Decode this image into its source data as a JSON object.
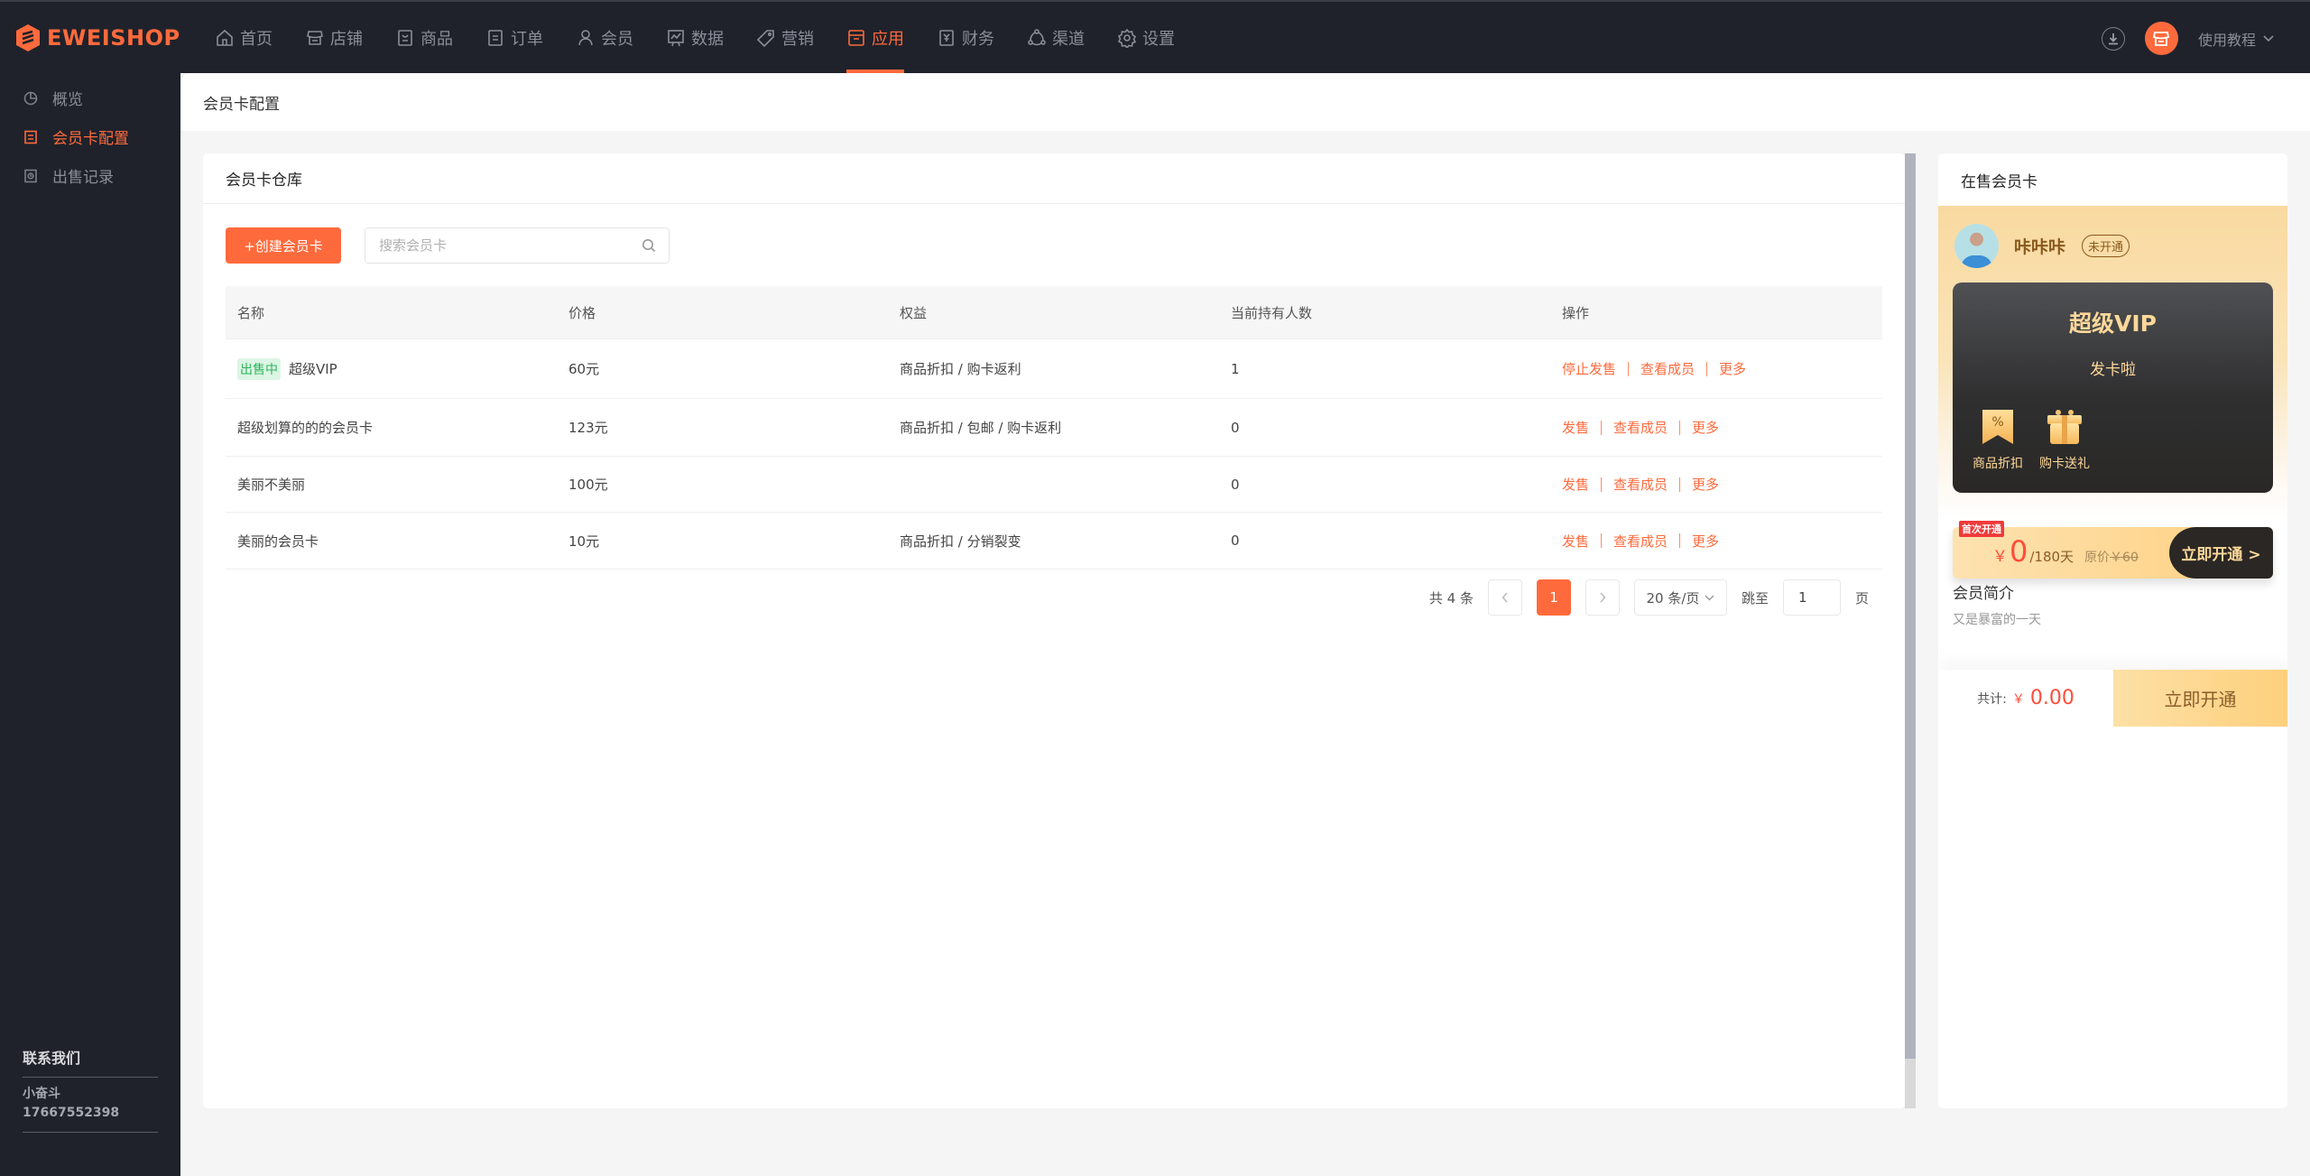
{
  "app": {
    "brand": "EWEISHOP"
  },
  "nav": {
    "items": [
      {
        "label": "首页",
        "icon": "home-icon",
        "active": false
      },
      {
        "label": "店铺",
        "icon": "store-icon",
        "active": false
      },
      {
        "label": "商品",
        "icon": "goods-icon",
        "active": false
      },
      {
        "label": "订单",
        "icon": "order-icon",
        "active": false
      },
      {
        "label": "会员",
        "icon": "user-icon",
        "active": false
      },
      {
        "label": "数据",
        "icon": "chart-icon",
        "active": false
      },
      {
        "label": "营销",
        "icon": "tag-icon",
        "active": false
      },
      {
        "label": "应用",
        "icon": "box-icon",
        "active": true
      },
      {
        "label": "财务",
        "icon": "finance-icon",
        "active": false
      },
      {
        "label": "渠道",
        "icon": "channel-icon",
        "active": false
      },
      {
        "label": "设置",
        "icon": "gear-icon",
        "active": false
      }
    ],
    "tutorial_label": "使用教程"
  },
  "sidebar": {
    "items": [
      {
        "label": "概览",
        "icon": "pie-icon",
        "active": false
      },
      {
        "label": "会员卡配置",
        "icon": "doc-icon",
        "active": true
      },
      {
        "label": "出售记录",
        "icon": "record-icon",
        "active": false
      }
    ],
    "contact": {
      "title": "联系我们",
      "name": "小奋斗",
      "phone": "17667552398"
    }
  },
  "page": {
    "title": "会员卡配置"
  },
  "warehouse": {
    "title": "会员卡仓库",
    "create_label": "+创建会员卡",
    "search_placeholder": "搜索会员卡",
    "search_value": "",
    "columns": [
      "名称",
      "价格",
      "权益",
      "当前持有人数",
      "操作"
    ],
    "rows": [
      {
        "status": "出售中",
        "name": "超级VIP",
        "price": "60元",
        "benefits": "商品折扣 / 购卡返利",
        "holders": "1",
        "ops": [
          "停止发售",
          "查看成员",
          "更多"
        ]
      },
      {
        "status": "",
        "name": "超级划算的的的会员卡",
        "price": "123元",
        "benefits": "商品折扣 / 包邮 / 购卡返利",
        "holders": "0",
        "ops": [
          "发售",
          "查看成员",
          "更多"
        ]
      },
      {
        "status": "",
        "name": "美丽不美丽",
        "price": "100元",
        "benefits": "",
        "holders": "0",
        "ops": [
          "发售",
          "查看成员",
          "更多"
        ]
      },
      {
        "status": "",
        "name": "美丽的会员卡",
        "price": "10元",
        "benefits": "商品折扣 / 分销裂变",
        "holders": "0",
        "ops": [
          "发售",
          "查看成员",
          "更多"
        ]
      }
    ],
    "pagination": {
      "total_label": "共 4 条",
      "current_page": "1",
      "page_size_label": "20 条/页",
      "jump_label": "跳至",
      "jump_value": "1",
      "page_suffix": "页"
    }
  },
  "on_sale": {
    "title": "在售会员卡",
    "user_name": "咔咔咔",
    "user_status": "未开通",
    "card_name": "超级VIP",
    "card_subtitle": "发卡啦",
    "benefits": [
      {
        "label": "商品折扣",
        "icon": "discount-icon"
      },
      {
        "label": "购卡送礼",
        "icon": "gift-icon"
      }
    ],
    "offer": {
      "tag": "首次开通",
      "currency": "￥",
      "price": "0",
      "period": "/180天",
      "original_label": "原价",
      "original_price": "￥60",
      "button_label": "立即开通 >"
    },
    "intro_title": "会员简介",
    "intro_text": "又是暴富的一天",
    "footer": {
      "total_label": "共计:",
      "currency": "￥",
      "total_value": "0.00",
      "button_label": "立即开通"
    }
  },
  "colors": {
    "accent": "#ff6a3c",
    "nav_bg": "#1f222b",
    "success": "#2db55d",
    "price_red": "#ff4d3a",
    "gold": "#fdd89a"
  }
}
